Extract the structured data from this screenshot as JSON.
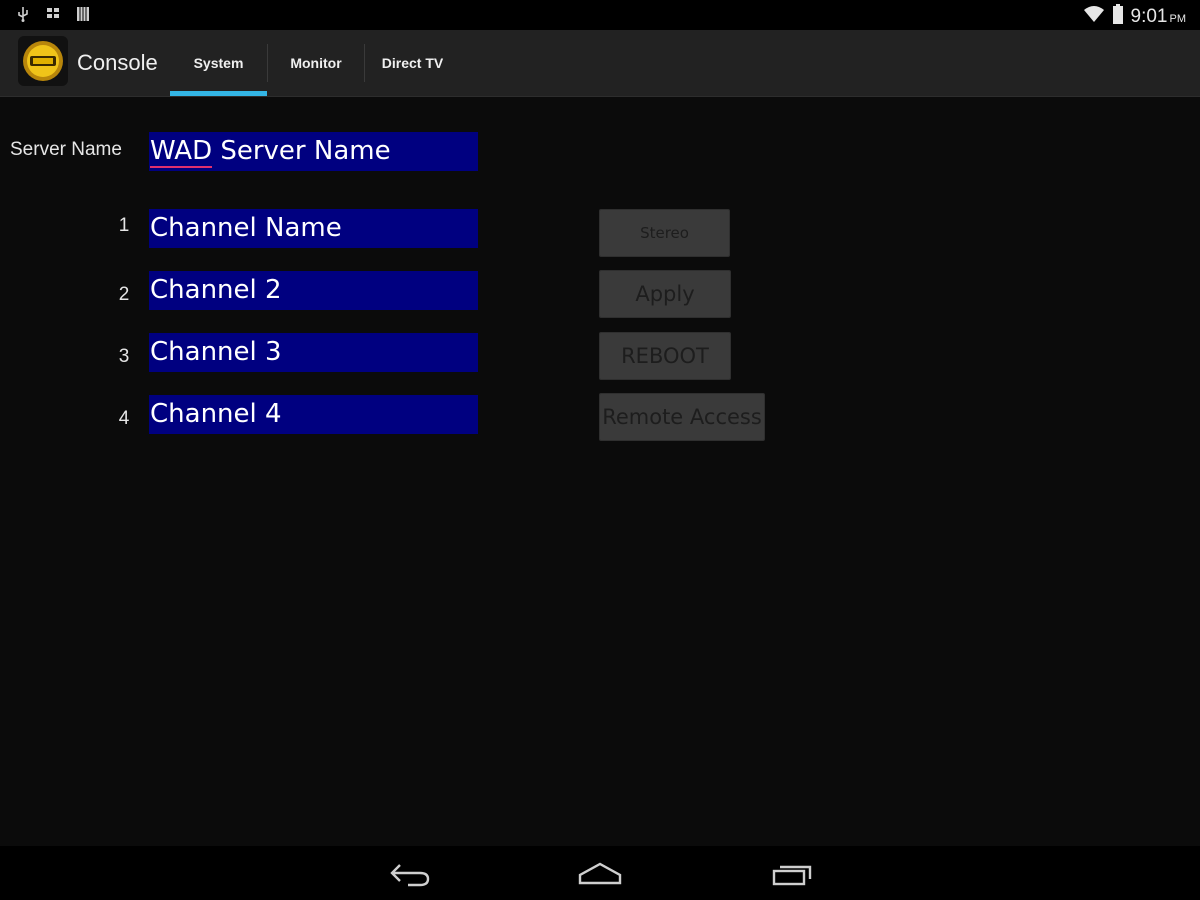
{
  "status_bar": {
    "left_icons": [
      "usb-icon",
      "bbm-icon",
      "storage-icon"
    ],
    "wifi": "wifi-icon",
    "battery": "battery-icon",
    "time": "9:01",
    "ampm": "PM"
  },
  "action_bar": {
    "app_logo": "app-logo-icon",
    "title": "Console",
    "tabs": [
      {
        "label": "System",
        "active": true
      },
      {
        "label": "Monitor",
        "active": false
      },
      {
        "label": "Direct TV",
        "active": false
      }
    ],
    "accent_color": "#33b5e5"
  },
  "form": {
    "server_label": "Server Name",
    "server_value_prefix": "WAD",
    "server_value_rest": " Server Name",
    "channels": [
      {
        "number": "1",
        "value": "Channel Name"
      },
      {
        "number": "2",
        "value": "Channel 2"
      },
      {
        "number": "3",
        "value": "Channel 3"
      },
      {
        "number": "4",
        "value": "Channel 4"
      }
    ],
    "field_color": "#000080"
  },
  "buttons": {
    "stereo": "Stereo",
    "apply": "Apply",
    "reboot": "REBOOT",
    "remote_access": "Remote Access"
  },
  "nav_bar": {
    "icons": [
      "back-icon",
      "home-icon",
      "recent-apps-icon"
    ]
  }
}
